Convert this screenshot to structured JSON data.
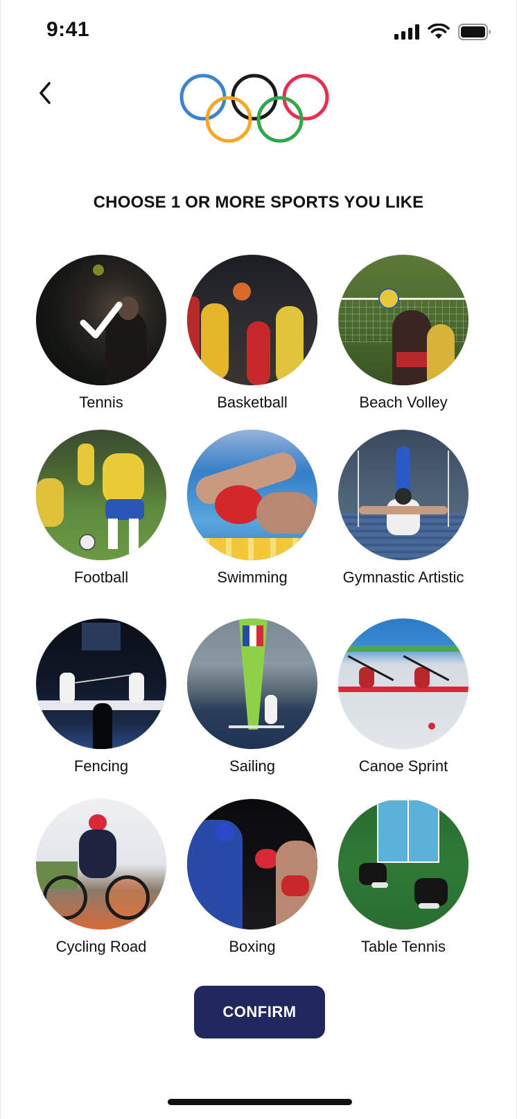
{
  "status_bar": {
    "time": "9:41",
    "signal_icon": "signal-bars-icon",
    "wifi_icon": "wifi-icon",
    "battery_icon": "battery-icon"
  },
  "header": {
    "back_icon": "chevron-left-icon",
    "logo": "olympic-rings-logo"
  },
  "title": "CHOOSE 1 OR MORE SPORTS YOU LIKE",
  "sports": [
    {
      "label": "Tennis",
      "selected": true
    },
    {
      "label": "Basketball",
      "selected": false
    },
    {
      "label": "Beach Volley",
      "selected": false
    },
    {
      "label": "Football",
      "selected": false
    },
    {
      "label": "Swimming",
      "selected": false
    },
    {
      "label": "Gymnastic Artistic",
      "selected": false
    },
    {
      "label": "Fencing",
      "selected": false
    },
    {
      "label": "Sailing",
      "selected": false
    },
    {
      "label": "Canoe Sprint",
      "selected": false
    },
    {
      "label": "Cycling Road",
      "selected": false
    },
    {
      "label": "Boxing",
      "selected": false
    },
    {
      "label": "Table Tennis",
      "selected": false
    }
  ],
  "confirm_label": "CONFIRM",
  "colors": {
    "confirm_bg": "#20285e",
    "ring_blue": "#3a83cf",
    "ring_black": "#1a1a1a",
    "ring_red": "#e5304f",
    "ring_yellow": "#f5a623",
    "ring_green": "#30a84a"
  }
}
